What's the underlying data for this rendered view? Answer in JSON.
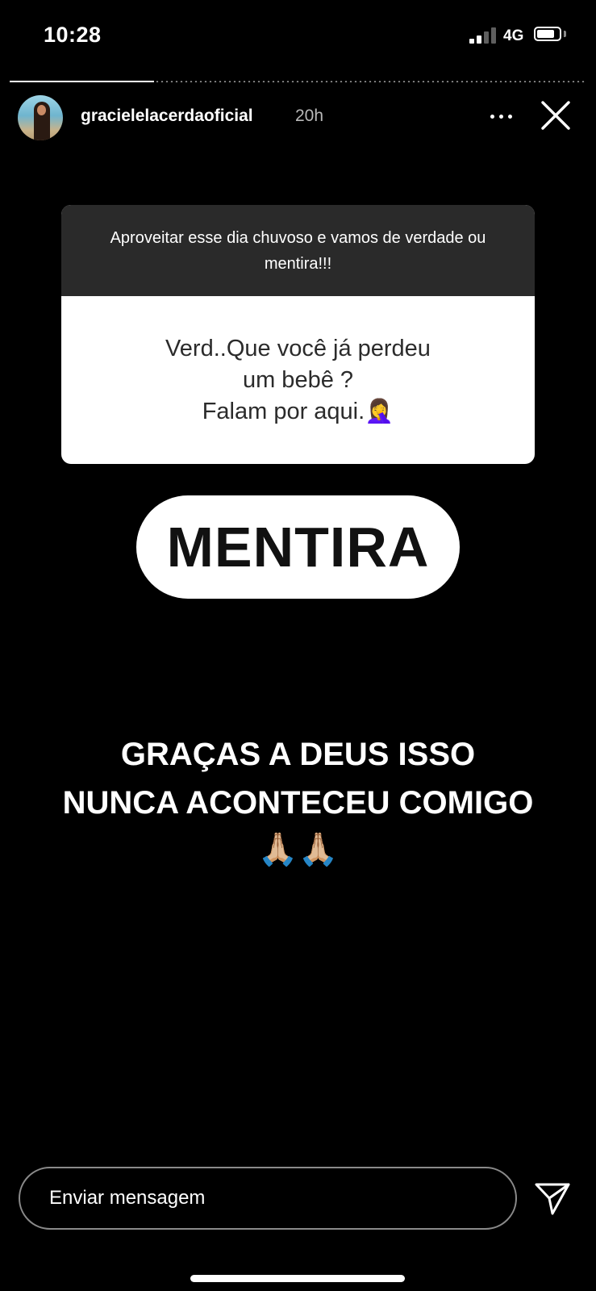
{
  "status_bar": {
    "time": "10:28",
    "network": "4G",
    "signal_bars_active": 2,
    "signal_bars_total": 4,
    "battery_level": 0.8
  },
  "story": {
    "progress": 0.25,
    "username": "gracielelacerdaoficial",
    "time_ago": "20h",
    "avatar_icon": "profile-photo",
    "more_icon": "more-horizontal-icon",
    "close_icon": "close-icon"
  },
  "question_sticker": {
    "prompt": "Aproveitar esse dia chuvoso e vamos de verdade ou mentira!!!",
    "answer_lines": [
      "Verd..Que você já perdeu",
      "um bebê ?",
      "Falam por aqui.🤦‍♀️"
    ]
  },
  "response": {
    "label": "MENTIRA"
  },
  "caption": {
    "line1": "GRAÇAS A DEUS ISSO",
    "line2": "NUNCA ACONTECEU COMIGO",
    "emoji": "🙏🏼🙏🏼"
  },
  "reply_bar": {
    "placeholder": "Enviar mensagem",
    "send_icon": "send-icon"
  },
  "colors": {
    "background": "#000000",
    "sticker_header": "#2a2a2a",
    "sticker_body": "#ffffff",
    "muted_text": "#b8b8b8"
  }
}
